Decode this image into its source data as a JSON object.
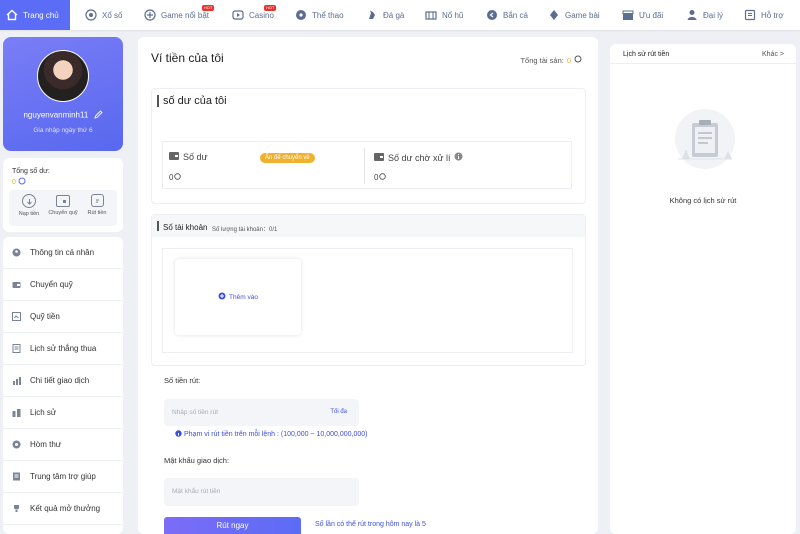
{
  "nav": {
    "items": [
      {
        "label": "Trang chủ",
        "icon": "home-icon"
      },
      {
        "label": "Xổ số",
        "icon": "lottery-icon"
      },
      {
        "label": "Game nổi bật",
        "icon": "featured-game-icon",
        "badge": "HOT"
      },
      {
        "label": "Casino",
        "icon": "casino-icon",
        "badge": "HOT"
      },
      {
        "label": "Thể thao",
        "icon": "sports-icon"
      },
      {
        "label": "Đá gà",
        "icon": "cockfight-icon"
      },
      {
        "label": "Nổ hũ",
        "icon": "slots-icon"
      },
      {
        "label": "Bắn cá",
        "icon": "fishing-icon"
      },
      {
        "label": "Game bài",
        "icon": "card-game-icon"
      },
      {
        "label": "Ưu đãi",
        "icon": "promotion-icon"
      },
      {
        "label": "Đại lý",
        "icon": "agent-icon"
      },
      {
        "label": "Hỗ trợ",
        "icon": "support-icon"
      }
    ]
  },
  "profile": {
    "username": "nguyenvanminh11",
    "joined": "Gia nhập ngày thứ 6"
  },
  "balance": {
    "label": "Tổng số dư:",
    "value": "0",
    "actions": [
      {
        "label": "Nạp tiền",
        "icon": "deposit-icon"
      },
      {
        "label": "Chuyển quỹ",
        "icon": "transfer-icon"
      },
      {
        "label": "Rút tiền",
        "icon": "withdraw-icon"
      }
    ]
  },
  "sidebar": {
    "items": [
      {
        "label": "Thông tin cá nhân",
        "icon": "user-icon"
      },
      {
        "label": "Chuyển quỹ",
        "icon": "wallet-icon"
      },
      {
        "label": "Quỹ tiền",
        "icon": "fund-icon"
      },
      {
        "label": "Lịch sử thắng thua",
        "icon": "history-icon"
      },
      {
        "label": "Chi tiết giao dịch",
        "icon": "transaction-icon"
      },
      {
        "label": "Lịch sử",
        "icon": "clock-icon"
      },
      {
        "label": "Hòm thư",
        "icon": "mail-icon"
      },
      {
        "label": "Trung tâm trợ giúp",
        "icon": "help-icon"
      },
      {
        "label": "Kết quả mở thưởng",
        "icon": "trophy-icon"
      }
    ]
  },
  "wallet": {
    "title": "Ví tiền của tôi",
    "total_label": "Tổng tài sản:",
    "total_value": "0",
    "my_balance_title": "số dư của tôi",
    "balance_label": "Số dư",
    "hide_transfer_label": "Ẩn để chuyển về",
    "balance_value": "0",
    "pending_label": "Số dư chờ xử lí",
    "pending_value": "0"
  },
  "account": {
    "title": "Số tài khoản",
    "count_label": "Số lượng tài khoản：0/1",
    "add_label": "Thêm vào"
  },
  "withdraw": {
    "amount_label": "Số tiền rút:",
    "amount_placeholder": "Nhập số tiền rút",
    "max_label": "Tối đa",
    "range_note": "Phạm vi rút tiền trên mỗi lệnh : (100,000 ~ 10,000,000,000)",
    "password_label": "Mật khẩu giao dịch:",
    "password_placeholder": "Mật khẩu rút tiền",
    "submit_label": "Rút ngay",
    "limit_note": "Số lần có thể rút trong hôm nay là 5"
  },
  "history": {
    "title": "Lịch sử rút tiền",
    "more_label": "Khác >",
    "empty_text": "Không có lịch sử rút"
  },
  "colors": {
    "accent": "#5b6cf6",
    "gold": "#f0b12e",
    "hot": "#e8322b"
  }
}
